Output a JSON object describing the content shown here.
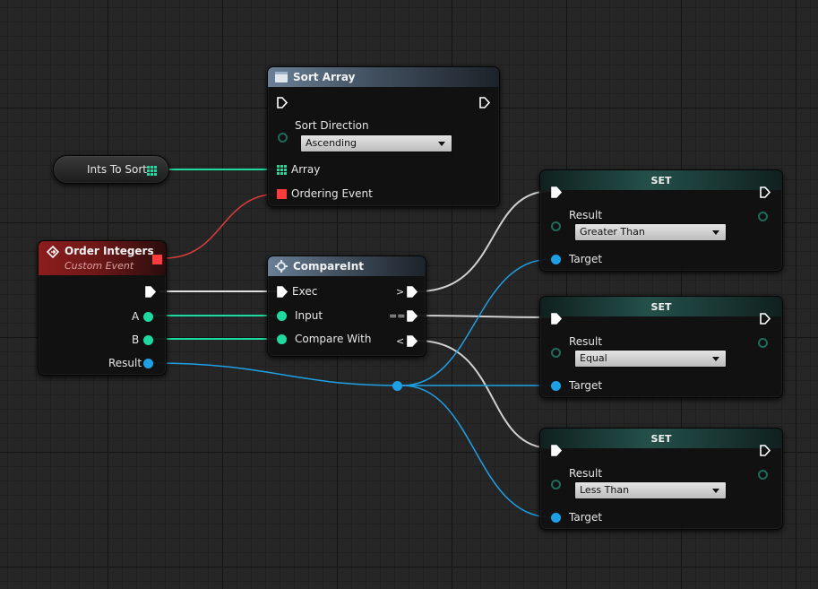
{
  "colors": {
    "exec": "#ffffff",
    "integer": "#1ed9a0",
    "array_pin": "#1ed9a0",
    "enum_result": "#1ea0e6",
    "event_delegate": "#ff3b3b",
    "wire_event": "#e03c3c"
  },
  "variable_node": {
    "label": "Ints To Sort",
    "icon": "array-grid-icon"
  },
  "sort_array": {
    "title": "Sort Array",
    "icon": "function-icon",
    "sort_direction_label": "Sort Direction",
    "sort_direction_value": "Ascending",
    "array_label": "Array",
    "ordering_event_label": "Ordering Event"
  },
  "custom_event": {
    "title": "Order Integers",
    "subtitle": "Custom Event",
    "icon": "event-icon",
    "pins": {
      "a": "A",
      "b": "B",
      "result": "Result"
    }
  },
  "compare_int": {
    "title": "CompareInt",
    "icon": "gear-icon",
    "exec_label": "Exec",
    "input_label": "Input",
    "compare_with_label": "Compare With",
    "out_greater": ">",
    "out_equal": "==",
    "out_less": "<"
  },
  "set_nodes": [
    {
      "title": "SET",
      "result_label": "Result",
      "value": "Greater Than",
      "target_label": "Target"
    },
    {
      "title": "SET",
      "result_label": "Result",
      "value": "Equal",
      "target_label": "Target"
    },
    {
      "title": "SET",
      "result_label": "Result",
      "value": "Less Than",
      "target_label": "Target"
    }
  ]
}
